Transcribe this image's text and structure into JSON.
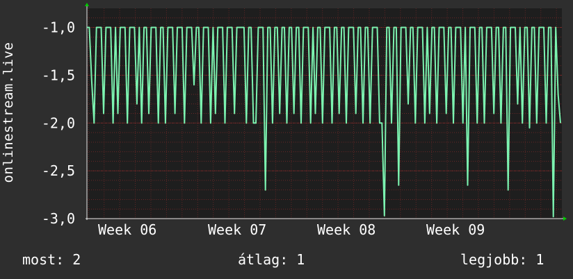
{
  "chart_data": {
    "type": "line",
    "ylabel": "onlinestream.live",
    "yticks": [
      "-1,0",
      "-1,5",
      "-2,0",
      "-2,5",
      "-3,0"
    ],
    "ylim": [
      -3.0,
      -0.8
    ],
    "xticks": [
      "Week 06",
      "Week 07",
      "Week 08",
      "Week 09"
    ],
    "grid": true,
    "colors": {
      "line": "#7cf3b0",
      "plot_bg": "#1e1e1e",
      "page_bg": "#2e2e2e",
      "grid": "#8b2b2b",
      "axis_arrow": "#00cc00"
    },
    "series": [
      {
        "values": [
          -1.0,
          -1.0,
          -1.55,
          -2.0,
          -1.0,
          -1.0,
          -1.0,
          -1.9,
          -1.0,
          -1.0,
          -1.0,
          -2.0,
          -1.0,
          -1.9,
          -1.0,
          -1.0,
          -1.0,
          -2.0,
          -1.0,
          -1.0,
          -1.0,
          -1.8,
          -1.0,
          -2.0,
          -1.0,
          -1.0,
          -1.9,
          -1.0,
          -1.0,
          -1.0,
          -2.0,
          -1.0,
          -1.0,
          -2.0,
          -1.0,
          -1.0,
          -1.0,
          -1.9,
          -1.0,
          -1.0,
          -1.0,
          -2.0,
          -1.0,
          -1.0,
          -1.0,
          -1.6,
          -1.0,
          -1.0,
          -2.0,
          -1.0,
          -1.0,
          -1.0,
          -2.0,
          -1.0,
          -1.9,
          -1.0,
          -1.0,
          -1.0,
          -2.0,
          -1.0,
          -1.0,
          -1.0,
          -1.9,
          -1.0,
          -1.0,
          -1.0,
          -1.0,
          -2.0,
          -1.0,
          -1.0,
          -2.0,
          -2.0,
          -1.0,
          -1.0,
          -1.0,
          -2.7,
          -1.0,
          -1.0,
          -2.0,
          -1.0,
          -1.0,
          -1.9,
          -1.0,
          -1.0,
          -2.0,
          -1.0,
          -1.0,
          -1.9,
          -1.0,
          -1.0,
          -2.0,
          -1.0,
          -1.0,
          -1.0,
          -2.0,
          -1.0,
          -1.9,
          -1.0,
          -1.0,
          -2.0,
          -1.0,
          -1.0,
          -1.0,
          -2.0,
          -1.0,
          -1.0,
          -1.9,
          -1.0,
          -1.0,
          -2.0,
          -1.0,
          -1.0,
          -1.0,
          -1.9,
          -1.0,
          -1.0,
          -2.0,
          -1.0,
          -1.0,
          -2.0,
          -1.0,
          -1.0,
          -1.0,
          -2.0,
          -2.0,
          -2.97,
          -1.0,
          -1.0,
          -2.0,
          -1.0,
          -1.0,
          -2.65,
          -1.0,
          -1.0,
          -1.0,
          -1.8,
          -1.0,
          -1.0,
          -2.0,
          -1.0,
          -1.0,
          -1.0,
          -2.0,
          -1.0,
          -1.9,
          -1.0,
          -1.0,
          -2.0,
          -1.0,
          -1.0,
          -1.0,
          -1.9,
          -1.0,
          -1.0,
          -2.0,
          -1.0,
          -1.0,
          -1.0,
          -2.0,
          -1.0,
          -2.65,
          -1.0,
          -1.0,
          -1.0,
          -2.0,
          -1.0,
          -1.0,
          -2.0,
          -1.0,
          -1.0,
          -1.0,
          -1.9,
          -1.0,
          -1.0,
          -2.0,
          -1.0,
          -1.0,
          -2.7,
          -1.0,
          -1.0,
          -1.0,
          -1.8,
          -1.0,
          -2.0,
          -1.0,
          -1.0,
          -2.05,
          -1.0,
          -1.0,
          -2.0,
          -1.0,
          -1.0,
          -1.0,
          -2.0,
          -1.0,
          -1.0,
          -2.98,
          -1.0,
          -1.7,
          -2.0
        ]
      }
    ]
  },
  "footer": {
    "now": "most: 2",
    "avg": "átlag: 1",
    "best": "legjobb: 1"
  }
}
